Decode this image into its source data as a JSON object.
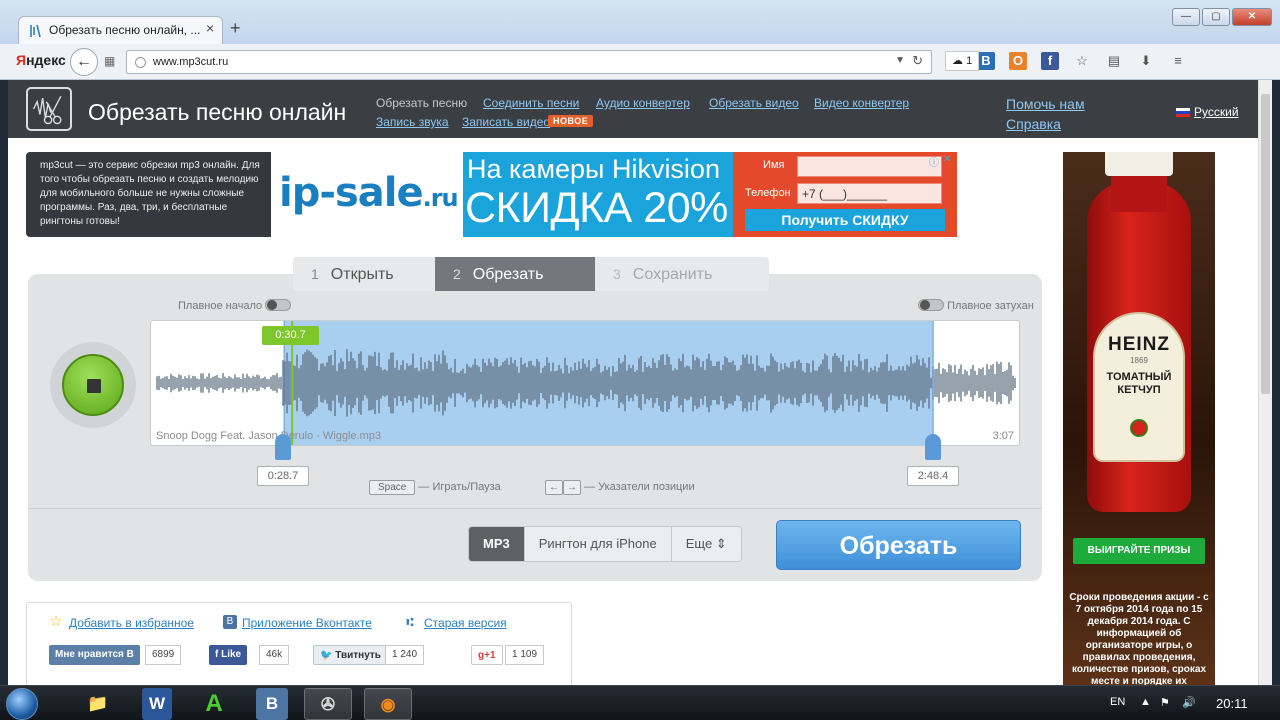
{
  "browser": {
    "tab_title": "Обрезать песню онлайн, ...",
    "tab_close": "×",
    "tab_add": "+",
    "url": "www.mp3cut.ru",
    "yandex_y": "Я",
    "yandex_rest": "ндекс",
    "bookmark_count": "1"
  },
  "site": {
    "title": "Обрезать песню онлайн",
    "nav": {
      "cut_song": "Обрезать песню",
      "join_songs": "Соединить песни",
      "audio_converter": "Аудио конвертер",
      "cut_video": "Обрезать видео",
      "video_converter": "Видео конвертер",
      "record_sound": "Запись звука",
      "record_video": "Записать видео",
      "new_badge": "НОВОЕ"
    },
    "help": "Помочь нам",
    "reference": "Справка",
    "language": "Русский",
    "intro": "mp3cut — это сервис обрезки mp3 онлайн. Для того чтобы обрезать песню и создать мелодию для мобильного больше не нужны сложные программы. Раз, два, три, и бесплатные рингтоны готовы!"
  },
  "ad_banner": {
    "brand": "ip-sale",
    "brand_tld": ".ru",
    "line1": "На камеры Hikvision",
    "line2": "СКИДКА 20%",
    "name_label": "Имя",
    "phone_label": "Телефон",
    "phone_value": "+7 (___)______",
    "cta": "Получить СКИДКУ"
  },
  "side_ad": {
    "brand": "HEINZ",
    "year": "1869",
    "product": "ТОМАТНЫЙ КЕТЧУП",
    "cta": "ВЫИГРАЙТЕ ПРИЗЫ",
    "text": "Сроки проведения акции - с 7 октября 2014 года по 15 декабря 2014 года. С информацией об организаторе игры, о правилах проведения, количестве призов, сроках месте и порядке их"
  },
  "steps": [
    {
      "num": "1",
      "label": "Открыть"
    },
    {
      "num": "2",
      "label": "Обрезать"
    },
    {
      "num": "3",
      "label": "Сохранить"
    }
  ],
  "editor": {
    "fade_in": "Плавное начало",
    "fade_out": "Плавное затухан",
    "current_time": "0:30.7",
    "file_name": "Snoop Dogg Feat. Jason Derulo - Wiggle.mp3",
    "duration": "3:07",
    "start_time": "0:28.7",
    "end_time": "2:48.4",
    "hint_space_key": "Space",
    "hint_space": "— Играть/Пауза",
    "hint_arrows_left": "←",
    "hint_arrows_right": "→",
    "hint_arrows": "— Указатели позиции",
    "selection_start_fraction": 0.153,
    "selection_end_fraction": 0.899
  },
  "formats": {
    "mp3": "MP3",
    "iphone": "Рингтон для iPhone",
    "more": "Еще"
  },
  "cut_button": "Обрезать",
  "social": {
    "favorites": "Добавить в избранное",
    "vk_app": "Приложение Вконтакте",
    "old_version": "Старая версия",
    "vk_like": "Мне нравится",
    "vk_count": "6899",
    "fb_like": "Like",
    "fb_count": "46k",
    "tweet": "Твитнуть",
    "tweet_count": "1 240",
    "gplus": "+1",
    "gplus_count": "1 109"
  },
  "taskbar": {
    "lang": "EN",
    "time": "20:11"
  },
  "colors": {
    "accent_blue": "#3f8fd8",
    "play_green": "#5aa516",
    "header_dark": "#3b3f43"
  }
}
